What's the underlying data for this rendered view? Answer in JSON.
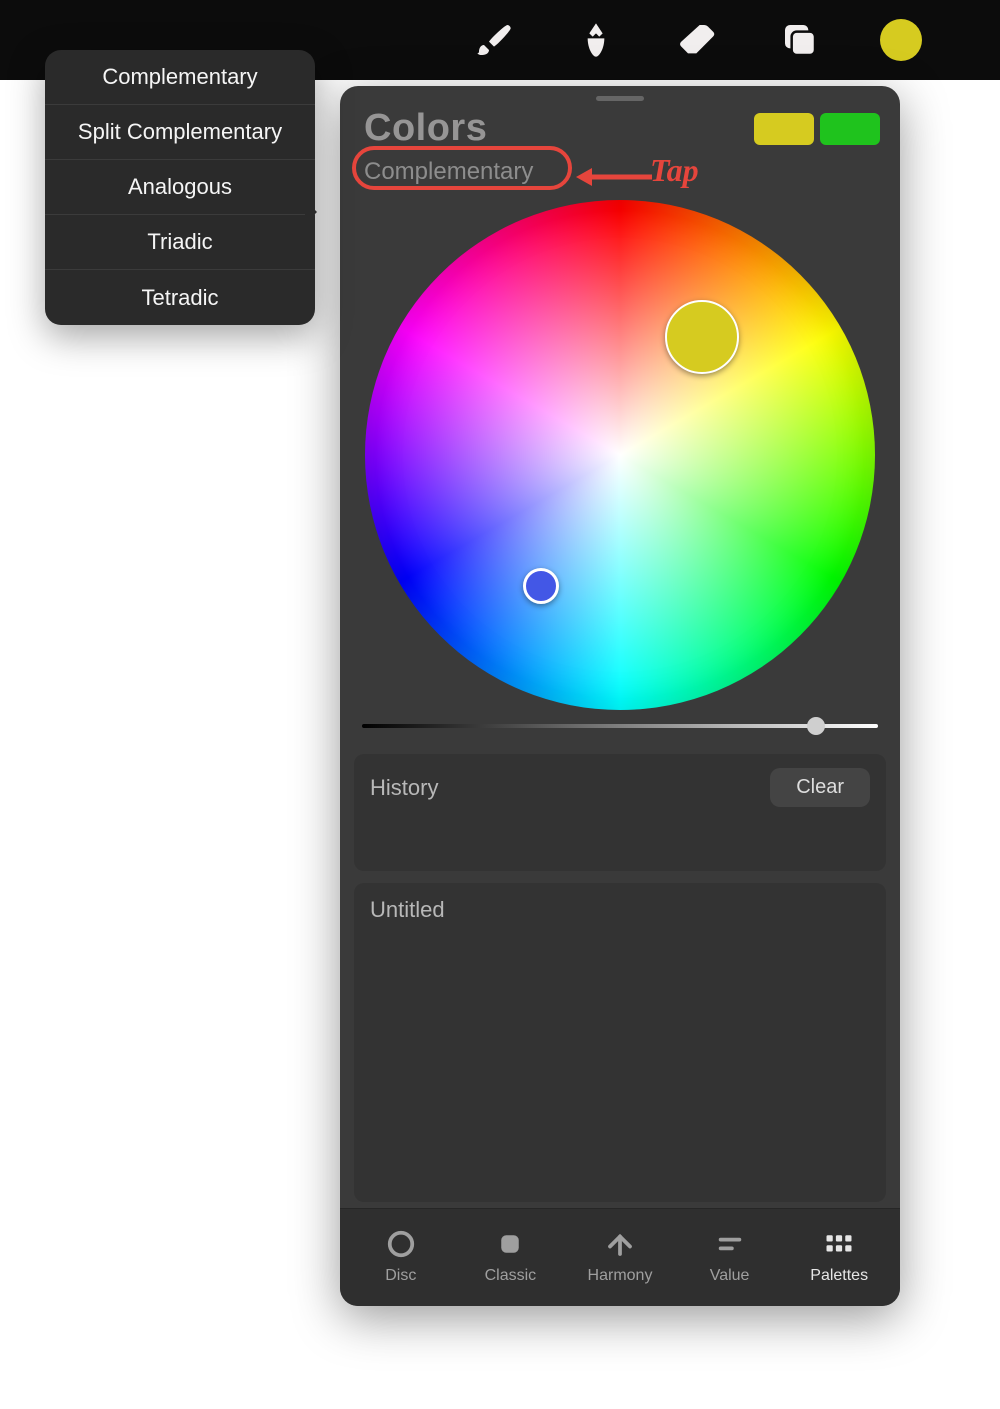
{
  "toolbar": {
    "brush_icon": "brush-icon",
    "smudge_icon": "smudge-icon",
    "erase_icon": "erase-icon",
    "layers_icon": "layers-icon",
    "current_color": "#d6cb20"
  },
  "harmony_menu": {
    "items": [
      "Complementary",
      "Split Complementary",
      "Analogous",
      "Triadic",
      "Tetradic"
    ],
    "selected_index": 2
  },
  "panel": {
    "title": "Colors",
    "harmony_label": "Complementary",
    "swatches": {
      "a": "#d6cb20",
      "b": "#1fc31d"
    },
    "brightness_slider": {
      "value": 88
    },
    "history": {
      "title": "History",
      "clear_label": "Clear"
    },
    "palette": {
      "title": "Untitled"
    },
    "tabs": [
      {
        "label": "Disc"
      },
      {
        "label": "Classic"
      },
      {
        "label": "Harmony"
      },
      {
        "label": "Value"
      },
      {
        "label": "Palettes"
      }
    ],
    "active_tab_index": 4
  },
  "annotation": {
    "text": "Tap"
  }
}
